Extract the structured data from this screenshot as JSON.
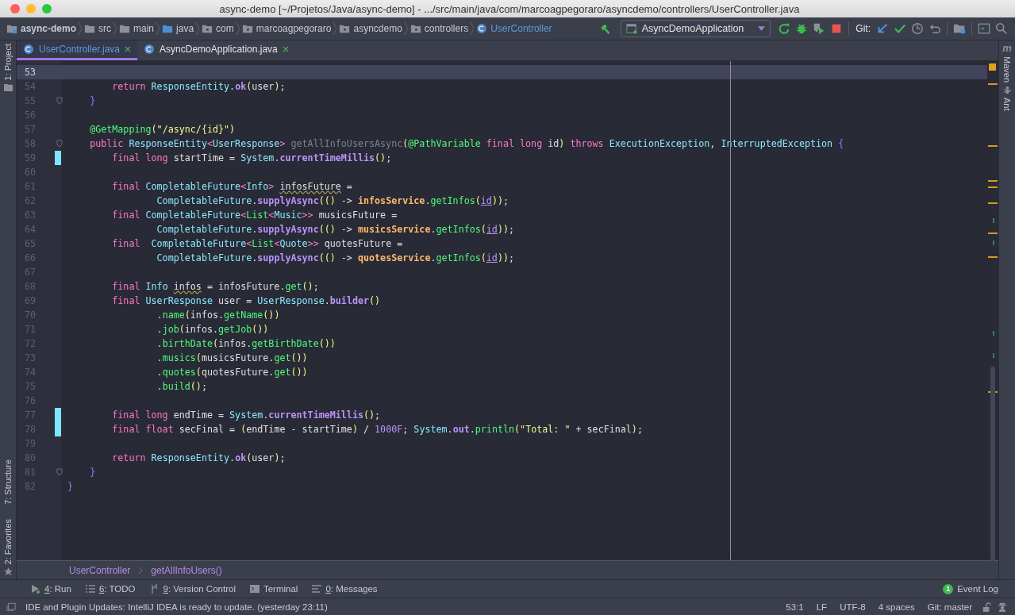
{
  "window": {
    "title": "async-demo [~/Projetos/Java/async-demo] - .../src/main/java/com/marcoagpegoraro/asyncdemo/controllers/UserController.java"
  },
  "nav_bar": {
    "path": [
      {
        "kind": "project",
        "label": "async-demo"
      },
      {
        "kind": "folder",
        "label": "src"
      },
      {
        "kind": "folder",
        "label": "main"
      },
      {
        "kind": "source",
        "label": "java"
      },
      {
        "kind": "package",
        "label": "com"
      },
      {
        "kind": "package",
        "label": "marcoagpegoraro"
      },
      {
        "kind": "package",
        "label": "asyncdemo"
      },
      {
        "kind": "package",
        "label": "controllers"
      },
      {
        "kind": "class",
        "label": "UserController"
      }
    ],
    "run_config": "AsyncDemoApplication",
    "git_label": "Git:"
  },
  "left_strip": [
    "1: Project",
    "7: Structure",
    "2: Favorites"
  ],
  "right_strip": {
    "logo": "m",
    "tabs": [
      "Maven",
      "Ant"
    ]
  },
  "tabs": [
    {
      "label": "UserController.java",
      "selected": true,
      "modified": true
    },
    {
      "label": "AsyncDemoApplication.java",
      "selected": false,
      "modified": false
    }
  ],
  "editor": {
    "lines": [
      {
        "number": "53",
        "current": true,
        "changed": false,
        "fold": false
      },
      {
        "number": "54",
        "current": false,
        "changed": false,
        "fold": false,
        "tokens": [
          {
            "kind": "keyword",
            "text": "        return "
          },
          {
            "kind": "type",
            "text": "ResponseEntity"
          },
          {
            "kind": "plain",
            "text": "."
          },
          {
            "kind": "method",
            "text": "ok"
          },
          {
            "kind": "paren",
            "text": "("
          },
          {
            "kind": "plain",
            "text": "user"
          },
          {
            "kind": "paren",
            "text": ")"
          },
          {
            "kind": "plain",
            "text": ";"
          }
        ]
      },
      {
        "number": "55",
        "current": false,
        "changed": false,
        "fold": true,
        "tokens": [
          {
            "kind": "brace",
            "text": "    }"
          }
        ]
      },
      {
        "number": "56",
        "current": false,
        "changed": false,
        "fold": false
      },
      {
        "number": "57",
        "current": false,
        "changed": false,
        "fold": false,
        "tokens": [
          {
            "kind": "annotation",
            "text": "    @GetMapping"
          },
          {
            "kind": "paren",
            "text": "("
          },
          {
            "kind": "string",
            "text": "\"/async/{id}\""
          },
          {
            "kind": "paren",
            "text": ")"
          }
        ]
      },
      {
        "number": "58",
        "current": false,
        "changed": false,
        "fold": true,
        "tokens": [
          {
            "kind": "keyword",
            "text": "    public "
          },
          {
            "kind": "type",
            "text": "ResponseEntity"
          },
          {
            "kind": "keyword",
            "text": "<"
          },
          {
            "kind": "type",
            "text": "UserResponse"
          },
          {
            "kind": "keyword",
            "text": "> "
          },
          {
            "kind": "unused",
            "text": "getAllInfoUsersAsync"
          },
          {
            "kind": "paren",
            "text": "("
          },
          {
            "kind": "annotation",
            "text": "@PathVariable "
          },
          {
            "kind": "keyword",
            "text": "final long"
          },
          {
            "kind": "plain",
            "text": " id"
          },
          {
            "kind": "paren",
            "text": ")"
          },
          {
            "kind": "keyword",
            "text": " throws "
          },
          {
            "kind": "type",
            "text": "ExecutionException"
          },
          {
            "kind": "plain",
            "text": ", "
          },
          {
            "kind": "type",
            "text": "InterruptedException"
          },
          {
            "kind": "brace",
            "text": " {"
          }
        ]
      },
      {
        "number": "59",
        "current": false,
        "changed": true,
        "fold": false,
        "tokens": [
          {
            "kind": "keyword",
            "text": "        final long"
          },
          {
            "kind": "plain",
            "text": " startTime = "
          },
          {
            "kind": "type",
            "text": "System"
          },
          {
            "kind": "plain",
            "text": "."
          },
          {
            "kind": "method",
            "text": "currentTimeMillis"
          },
          {
            "kind": "paren",
            "text": "()"
          },
          {
            "kind": "plain",
            "text": ";"
          }
        ]
      },
      {
        "number": "60",
        "current": false,
        "changed": false,
        "fold": false
      },
      {
        "number": "61",
        "current": false,
        "changed": false,
        "fold": false,
        "tokens": [
          {
            "kind": "keyword",
            "text": "        final "
          },
          {
            "kind": "type",
            "text": "CompletableFuture"
          },
          {
            "kind": "keyword",
            "text": "<"
          },
          {
            "kind": "type",
            "text": "Info"
          },
          {
            "kind": "keyword",
            "text": "> "
          },
          {
            "kind": "warn",
            "text": "infosFuture"
          },
          {
            "kind": "plain",
            "text": " ="
          }
        ]
      },
      {
        "number": "62",
        "current": false,
        "changed": false,
        "fold": false,
        "tokens": [
          {
            "kind": "type",
            "text": "                CompletableFuture"
          },
          {
            "kind": "plain",
            "text": "."
          },
          {
            "kind": "method",
            "text": "supplyAsync"
          },
          {
            "kind": "paren",
            "text": "(()"
          },
          {
            "kind": "plain",
            "text": " -> "
          },
          {
            "kind": "service",
            "text": "infosService"
          },
          {
            "kind": "plain",
            "text": "."
          },
          {
            "kind": "call",
            "text": "getInfos"
          },
          {
            "kind": "paren",
            "text": "("
          },
          {
            "kind": "param",
            "text": "id"
          },
          {
            "kind": "paren",
            "text": "))"
          },
          {
            "kind": "plain",
            "text": ";"
          }
        ]
      },
      {
        "number": "63",
        "current": false,
        "changed": false,
        "fold": false,
        "tokens": [
          {
            "kind": "keyword",
            "text": "        final "
          },
          {
            "kind": "type",
            "text": "CompletableFuture"
          },
          {
            "kind": "keyword",
            "text": "<"
          },
          {
            "kind": "call",
            "text": "List"
          },
          {
            "kind": "keyword",
            "text": "<"
          },
          {
            "kind": "type",
            "text": "Music"
          },
          {
            "kind": "keyword",
            "text": ">>"
          },
          {
            "kind": "plain",
            "text": " musicsFuture ="
          }
        ]
      },
      {
        "number": "64",
        "current": false,
        "changed": false,
        "fold": false,
        "tokens": [
          {
            "kind": "type",
            "text": "                CompletableFuture"
          },
          {
            "kind": "plain",
            "text": "."
          },
          {
            "kind": "method",
            "text": "supplyAsync"
          },
          {
            "kind": "paren",
            "text": "(()"
          },
          {
            "kind": "plain",
            "text": " -> "
          },
          {
            "kind": "service",
            "text": "musicsService"
          },
          {
            "kind": "plain",
            "text": "."
          },
          {
            "kind": "call",
            "text": "getInfos"
          },
          {
            "kind": "paren",
            "text": "("
          },
          {
            "kind": "param",
            "text": "id"
          },
          {
            "kind": "paren",
            "text": "))"
          },
          {
            "kind": "plain",
            "text": ";"
          }
        ]
      },
      {
        "number": "65",
        "current": false,
        "changed": false,
        "fold": false,
        "tokens": [
          {
            "kind": "keyword",
            "text": "        final  "
          },
          {
            "kind": "type",
            "text": "CompletableFuture"
          },
          {
            "kind": "keyword",
            "text": "<"
          },
          {
            "kind": "call",
            "text": "List"
          },
          {
            "kind": "keyword",
            "text": "<"
          },
          {
            "kind": "type",
            "text": "Quote"
          },
          {
            "kind": "keyword",
            "text": ">>"
          },
          {
            "kind": "plain",
            "text": " quotesFuture ="
          }
        ]
      },
      {
        "number": "66",
        "current": false,
        "changed": false,
        "fold": false,
        "tokens": [
          {
            "kind": "type",
            "text": "                CompletableFuture"
          },
          {
            "kind": "plain",
            "text": "."
          },
          {
            "kind": "method",
            "text": "supplyAsync"
          },
          {
            "kind": "paren",
            "text": "(()"
          },
          {
            "kind": "plain",
            "text": " -> "
          },
          {
            "kind": "service",
            "text": "quotesService"
          },
          {
            "kind": "plain",
            "text": "."
          },
          {
            "kind": "call",
            "text": "getInfos"
          },
          {
            "kind": "paren",
            "text": "("
          },
          {
            "kind": "param",
            "text": "id"
          },
          {
            "kind": "paren",
            "text": "))"
          },
          {
            "kind": "plain",
            "text": ";"
          }
        ]
      },
      {
        "number": "67",
        "current": false,
        "changed": false,
        "fold": false
      },
      {
        "number": "68",
        "current": false,
        "changed": false,
        "fold": false,
        "tokens": [
          {
            "kind": "keyword",
            "text": "        final "
          },
          {
            "kind": "type",
            "text": "Info "
          },
          {
            "kind": "warn",
            "text": "infos"
          },
          {
            "kind": "plain",
            "text": " = infosFuture."
          },
          {
            "kind": "call",
            "text": "get"
          },
          {
            "kind": "paren",
            "text": "()"
          },
          {
            "kind": "plain",
            "text": ";"
          }
        ]
      },
      {
        "number": "69",
        "current": false,
        "changed": false,
        "fold": false,
        "tokens": [
          {
            "kind": "keyword",
            "text": "        final "
          },
          {
            "kind": "type",
            "text": "UserResponse"
          },
          {
            "kind": "plain",
            "text": " user = "
          },
          {
            "kind": "type",
            "text": "UserResponse"
          },
          {
            "kind": "plain",
            "text": "."
          },
          {
            "kind": "method",
            "text": "builder"
          },
          {
            "kind": "paren",
            "text": "()"
          }
        ]
      },
      {
        "number": "70",
        "current": false,
        "changed": false,
        "fold": false,
        "tokens": [
          {
            "kind": "plain",
            "text": "                ."
          },
          {
            "kind": "call",
            "text": "name"
          },
          {
            "kind": "paren",
            "text": "("
          },
          {
            "kind": "plain",
            "text": "infos."
          },
          {
            "kind": "call",
            "text": "getName"
          },
          {
            "kind": "paren",
            "text": "())"
          }
        ]
      },
      {
        "number": "71",
        "current": false,
        "changed": false,
        "fold": false,
        "tokens": [
          {
            "kind": "plain",
            "text": "                ."
          },
          {
            "kind": "call",
            "text": "job"
          },
          {
            "kind": "paren",
            "text": "("
          },
          {
            "kind": "plain",
            "text": "infos."
          },
          {
            "kind": "call",
            "text": "getJob"
          },
          {
            "kind": "paren",
            "text": "())"
          }
        ]
      },
      {
        "number": "72",
        "current": false,
        "changed": false,
        "fold": false,
        "tokens": [
          {
            "kind": "plain",
            "text": "                ."
          },
          {
            "kind": "call",
            "text": "birthDate"
          },
          {
            "kind": "paren",
            "text": "("
          },
          {
            "kind": "plain",
            "text": "infos."
          },
          {
            "kind": "call",
            "text": "getBirthDate"
          },
          {
            "kind": "paren",
            "text": "())"
          }
        ]
      },
      {
        "number": "73",
        "current": false,
        "changed": false,
        "fold": false,
        "tokens": [
          {
            "kind": "plain",
            "text": "                ."
          },
          {
            "kind": "call",
            "text": "musics"
          },
          {
            "kind": "paren",
            "text": "("
          },
          {
            "kind": "plain",
            "text": "musicsFuture."
          },
          {
            "kind": "call",
            "text": "get"
          },
          {
            "kind": "paren",
            "text": "())"
          }
        ]
      },
      {
        "number": "74",
        "current": false,
        "changed": false,
        "fold": false,
        "tokens": [
          {
            "kind": "plain",
            "text": "                ."
          },
          {
            "kind": "call",
            "text": "quotes"
          },
          {
            "kind": "paren",
            "text": "("
          },
          {
            "kind": "plain",
            "text": "quotesFuture."
          },
          {
            "kind": "call",
            "text": "get"
          },
          {
            "kind": "paren",
            "text": "())"
          }
        ]
      },
      {
        "number": "75",
        "current": false,
        "changed": false,
        "fold": false,
        "tokens": [
          {
            "kind": "plain",
            "text": "                ."
          },
          {
            "kind": "call",
            "text": "build"
          },
          {
            "kind": "paren",
            "text": "()"
          },
          {
            "kind": "plain",
            "text": ";"
          }
        ]
      },
      {
        "number": "76",
        "current": false,
        "changed": false,
        "fold": false
      },
      {
        "number": "77",
        "current": false,
        "changed": true,
        "fold": false,
        "tokens": [
          {
            "kind": "keyword",
            "text": "        final long"
          },
          {
            "kind": "plain",
            "text": " endTime = "
          },
          {
            "kind": "type",
            "text": "System"
          },
          {
            "kind": "plain",
            "text": "."
          },
          {
            "kind": "method",
            "text": "currentTimeMillis"
          },
          {
            "kind": "paren",
            "text": "()"
          },
          {
            "kind": "plain",
            "text": ";"
          }
        ]
      },
      {
        "number": "78",
        "current": false,
        "changed": true,
        "fold": false,
        "tokens": [
          {
            "kind": "keyword",
            "text": "        final float"
          },
          {
            "kind": "plain",
            "text": " secFinal = "
          },
          {
            "kind": "paren",
            "text": "("
          },
          {
            "kind": "plain",
            "text": "endTime - startTime"
          },
          {
            "kind": "paren",
            "text": ")"
          },
          {
            "kind": "plain",
            "text": " / "
          },
          {
            "kind": "number",
            "text": "1000F"
          },
          {
            "kind": "plain",
            "text": "; "
          },
          {
            "kind": "type",
            "text": "System"
          },
          {
            "kind": "plain",
            "text": "."
          },
          {
            "kind": "method",
            "text": "out"
          },
          {
            "kind": "plain",
            "text": "."
          },
          {
            "kind": "call",
            "text": "println"
          },
          {
            "kind": "paren",
            "text": "("
          },
          {
            "kind": "string",
            "text": "\"Total: \""
          },
          {
            "kind": "plain",
            "text": " + secFinal"
          },
          {
            "kind": "paren",
            "text": ")"
          },
          {
            "kind": "plain",
            "text": ";"
          }
        ]
      },
      {
        "number": "79",
        "current": false,
        "changed": false,
        "fold": false
      },
      {
        "number": "80",
        "current": false,
        "changed": false,
        "fold": false,
        "tokens": [
          {
            "kind": "keyword",
            "text": "        return "
          },
          {
            "kind": "type",
            "text": "ResponseEntity"
          },
          {
            "kind": "plain",
            "text": "."
          },
          {
            "kind": "method",
            "text": "ok"
          },
          {
            "kind": "paren",
            "text": "("
          },
          {
            "kind": "plain",
            "text": "user"
          },
          {
            "kind": "paren",
            "text": ")"
          },
          {
            "kind": "plain",
            "text": ";"
          }
        ]
      },
      {
        "number": "81",
        "current": false,
        "changed": false,
        "fold": true,
        "tokens": [
          {
            "kind": "brace",
            "text": "    }"
          }
        ]
      },
      {
        "number": "82",
        "current": false,
        "changed": false,
        "fold": false,
        "tokens": [
          {
            "kind": "brace",
            "text": "}"
          }
        ]
      }
    ]
  },
  "breadcrumb": [
    "UserController",
    "getAllInfoUsers()"
  ],
  "tool_buttons": [
    {
      "kind": "run",
      "label": "4: Run"
    },
    {
      "kind": "todo",
      "label": "6: TODO"
    },
    {
      "kind": "vcs",
      "label": "9: Version Control"
    },
    {
      "kind": "terminal",
      "label": "Terminal"
    },
    {
      "kind": "messages",
      "label": "0: Messages"
    }
  ],
  "event_log": {
    "count": "1",
    "label": "Event Log"
  },
  "status_bar": {
    "message": "IDE and Plugin Updates: IntelliJ IDEA is ready to update. (yesterday 23:11)",
    "items": [
      "53:1",
      "LF",
      "UTF-8",
      "4 spaces",
      "Git: master"
    ]
  }
}
